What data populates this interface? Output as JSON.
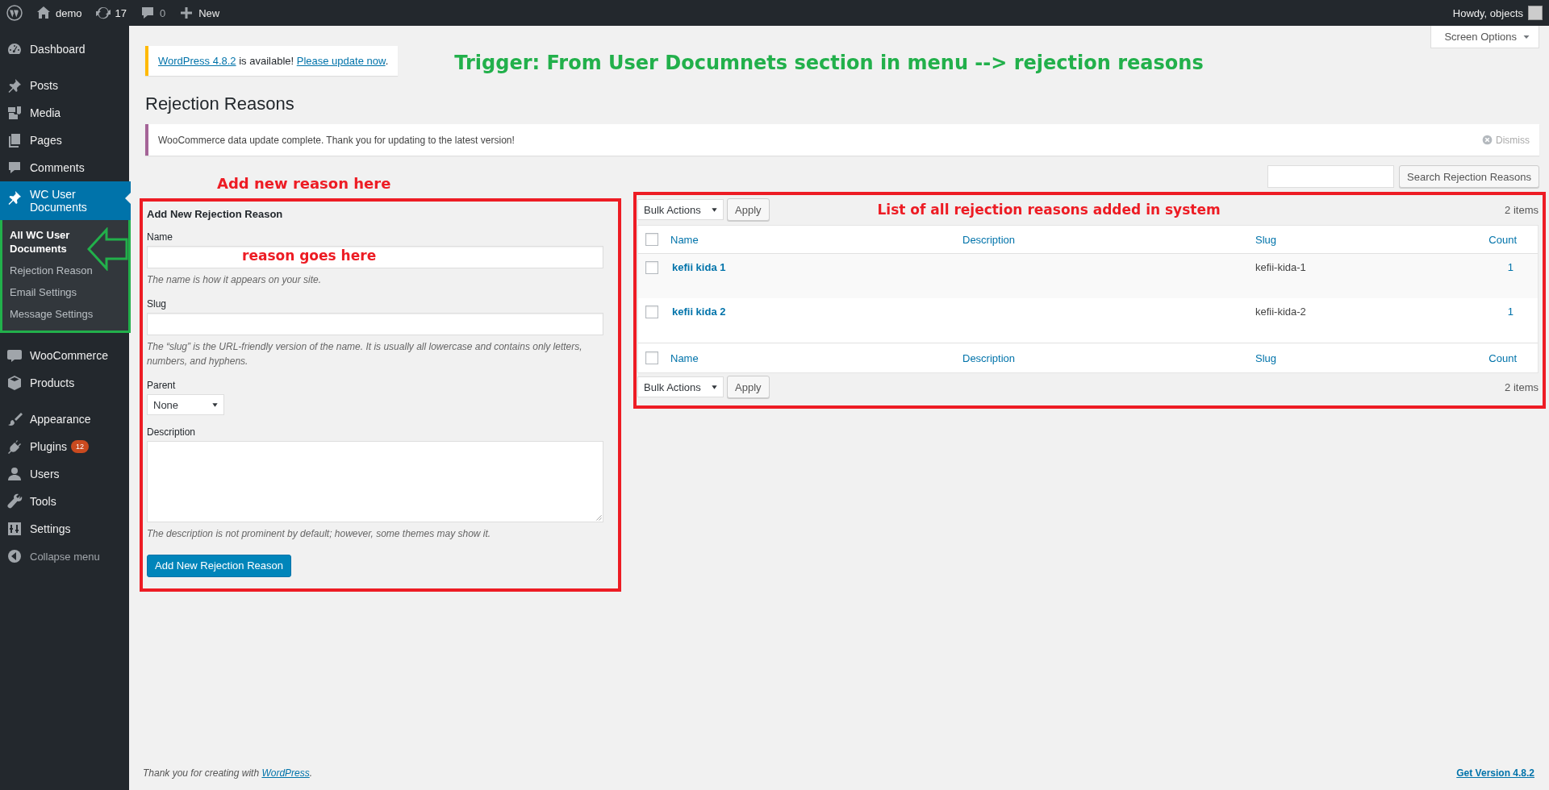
{
  "admin_bar": {
    "site": "demo",
    "updates": "17",
    "comments": "0",
    "new": "New",
    "account": "Howdy, objects"
  },
  "sidebar": {
    "items": [
      {
        "label": "Dashboard",
        "selected": false
      },
      {
        "label": "Posts",
        "selected": false
      },
      {
        "label": "Media",
        "selected": false
      },
      {
        "label": "Pages",
        "selected": false
      },
      {
        "label": "Comments",
        "selected": false
      },
      {
        "label": "WC User Documents",
        "selected": true,
        "children": [
          {
            "label": "All WC User Documents",
            "selected": true
          },
          {
            "label": "Rejection Reason",
            "selected": false
          },
          {
            "label": "Email Settings",
            "selected": false
          },
          {
            "label": "Message Settings",
            "selected": false
          }
        ]
      },
      {
        "label": "WooCommerce",
        "selected": false
      },
      {
        "label": "Products",
        "selected": false
      },
      {
        "label": "Appearance",
        "selected": false
      },
      {
        "label": "Plugins",
        "selected": false,
        "badge": "12"
      },
      {
        "label": "Users",
        "selected": false
      },
      {
        "label": "Tools",
        "selected": false
      },
      {
        "label": "Settings",
        "selected": false
      }
    ],
    "collapse": "Collapse menu"
  },
  "screen_options": "Screen Options",
  "update_notice": {
    "version_link": "WordPress 4.8.2",
    "text": " is available! ",
    "update_link": "Please update now",
    "end": "."
  },
  "annotations": [
    {
      "kind": "trigger",
      "text": "Trigger: From User Documnets section in menu  --> rejection reasons"
    },
    {
      "kind": "form",
      "text": "Add new reason here"
    },
    {
      "kind": "field",
      "text": "reason goes here"
    },
    {
      "kind": "table",
      "text": "List of all rejection reasons added in system"
    }
  ],
  "title": "Rejection Reasons",
  "notice": {
    "text": "WooCommerce data update complete. Thank you for updating to the latest version!",
    "dismiss": "Dismiss"
  },
  "form": {
    "heading": "Add New Rejection Reason",
    "fields": [
      {
        "kind": "text",
        "label": "Name",
        "hint": "The name is how it appears on your site."
      },
      {
        "kind": "text",
        "label": "Slug",
        "hint": "The “slug” is the URL-friendly version of the name. It is usually all lowercase and contains only letters, numbers, and hyphens."
      },
      {
        "kind": "select",
        "label": "Parent",
        "value": "None"
      },
      {
        "kind": "textarea",
        "label": "Description",
        "hint": "The description is not prominent by default; however, some themes may show it."
      }
    ],
    "submit": "Add New Rejection Reason"
  },
  "search": {
    "button": "Search Rejection Reasons"
  },
  "table": {
    "top_nav": {
      "bulk_action": "Bulk Actions",
      "apply": "Apply",
      "count": "2 items"
    },
    "header": {
      "columns": [
        "Name",
        "Description",
        "Slug",
        "Count"
      ],
      "checked": false
    },
    "footer": {
      "columns": [
        "Name",
        "Description",
        "Slug",
        "Count"
      ],
      "checked": false
    },
    "bottom_nav": {
      "bulk_action": "Bulk Actions",
      "apply": "Apply",
      "count": "2 items"
    },
    "rows": [
      {
        "name": "kefii kida 1",
        "slug": "kefii-kida-1",
        "count": "1",
        "checked": false
      },
      {
        "name": "kefii kida 2",
        "slug": "kefii-kida-2",
        "count": "1",
        "checked": false
      }
    ]
  },
  "footer": {
    "text": "Thank you for creating with ",
    "link": "WordPress",
    "end": ".",
    "version": "Get Version 4.8.2"
  }
}
